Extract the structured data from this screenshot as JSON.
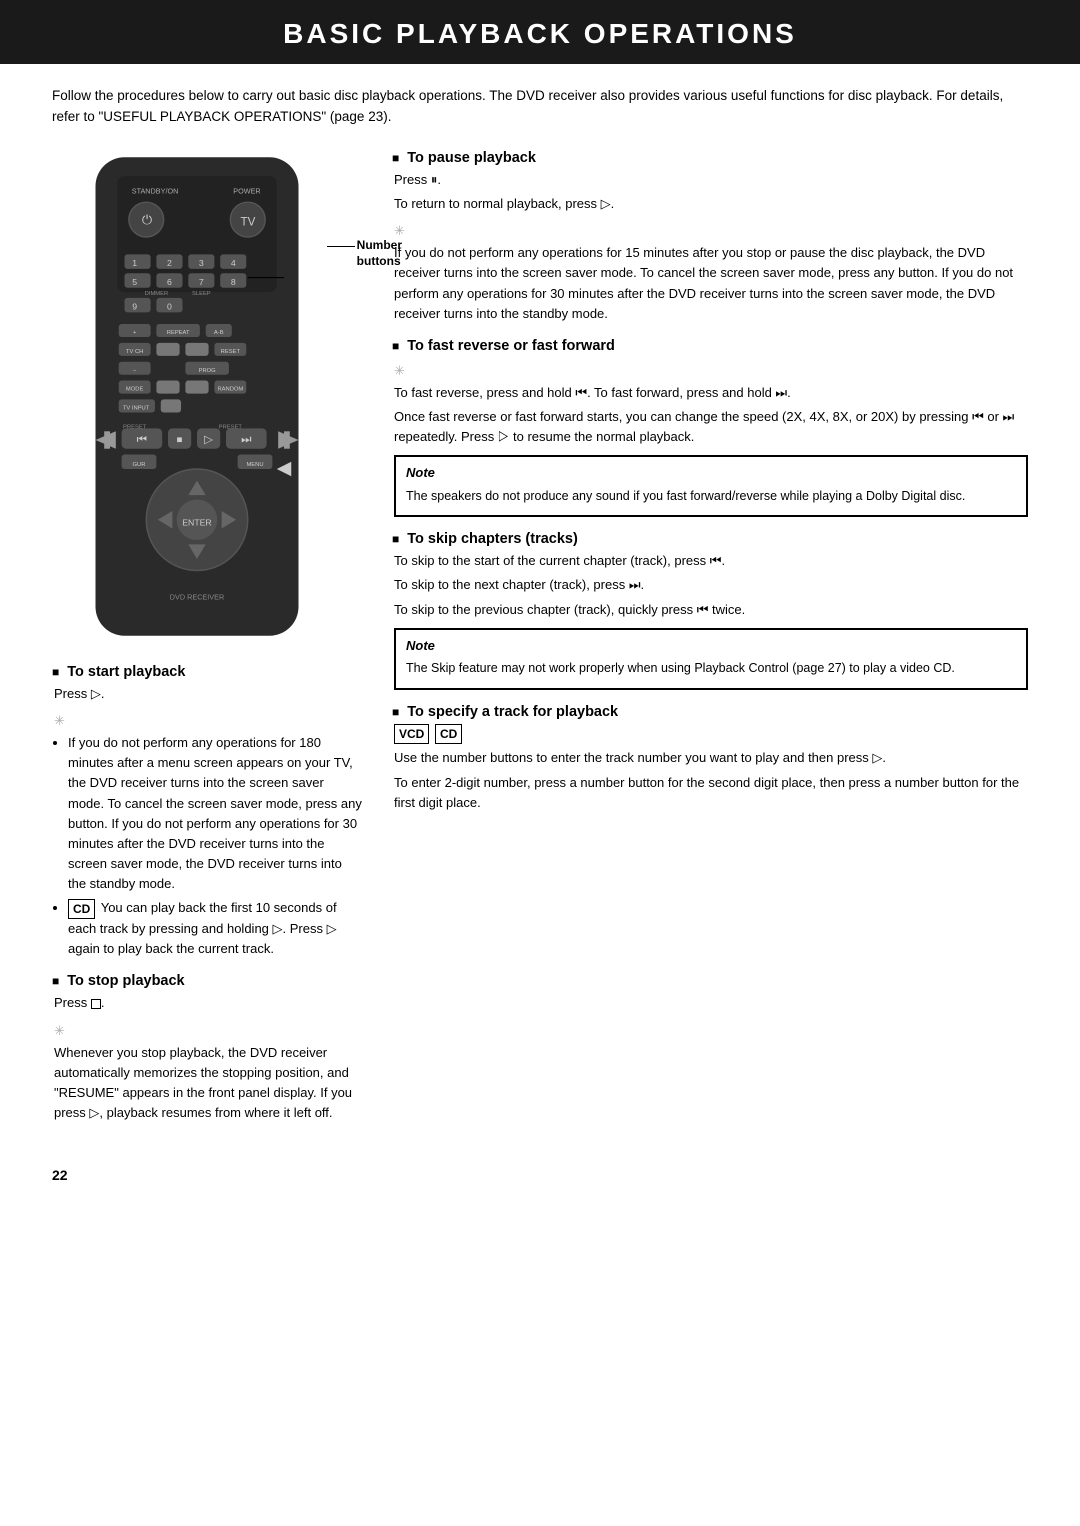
{
  "header": {
    "title": "BASIC PLAYBACK OPERATIONS"
  },
  "intro": {
    "text": "Follow the procedures below to carry out basic disc playback operations. The DVD receiver also provides various useful functions for disc playback. For details, refer to \"USEFUL PLAYBACK OPERATIONS\" (page 23)."
  },
  "remote_label": {
    "number_buttons": "Number\nbuttons"
  },
  "sections": {
    "start_playback": {
      "title": "To start playback",
      "press": "Press ▷.",
      "tip_bullets": [
        "If you do not perform any operations for 180 minutes after a menu screen appears on your TV, the DVD receiver turns into the screen saver mode. To cancel the screen saver mode, press any button. If you do not perform any operations for 30 minutes after the DVD receiver turns into the screen saver mode, the DVD receiver turns into the standby mode.",
        "CD  You can play back the first 10 seconds of each track by pressing and holding ▷. Press ▷ again to play back the current track."
      ]
    },
    "stop_playback": {
      "title": "To stop playback",
      "press": "Press □.",
      "tip_text": "Whenever you stop playback, the DVD receiver automatically memorizes the stopping position, and \"RESUME\" appears in the front panel display. If you press ▷, playback resumes from where it left off."
    },
    "pause_playback": {
      "title": "To pause playback",
      "press": "Press ⏸.",
      "return": "To return to normal playback, press ▷.",
      "tip_text": "If you do not perform any operations for 15 minutes after you stop or pause the disc playback, the DVD receiver turns into the screen saver mode. To cancel the screen saver mode, press any button. If you do not perform any operations for 30 minutes after the DVD receiver turns into the screen saver mode, the DVD receiver turns into the standby mode."
    },
    "fast_reverse_forward": {
      "title": "To fast reverse or fast forward",
      "tip_text": "To fast reverse, press and hold ⏮. To fast forward, press and hold ⏭.",
      "detail": "Once fast reverse or fast forward starts, you can change the speed (2X, 4X, 8X, or 20X) by pressing ⏮ or ⏭ repeatedly. Press ▷ to resume the normal playback.",
      "note_title": "Note",
      "note_text": "The speakers do not produce any sound if you fast forward/reverse while playing a Dolby Digital disc."
    },
    "skip_chapters": {
      "title": "To skip chapters (tracks)",
      "line1": "To skip to the start of the current chapter (track), press ⏮.",
      "line2": "To skip to the next chapter (track), press ⏭.",
      "line3": "To skip to the previous chapter (track), quickly press ⏮ twice.",
      "note_title": "Note",
      "note_text": "The Skip feature may not work properly when using Playback Control (page 27) to play a video CD."
    },
    "specify_track": {
      "title": "To specify a track for playback",
      "badges": [
        "VCD",
        "CD"
      ],
      "line1": "Use the number buttons to enter the track number you want to play and then press ▷.",
      "line2": "To enter 2-digit number, press a number button for the second digit place, then press a number button for the first digit place."
    }
  },
  "page_number": "22"
}
